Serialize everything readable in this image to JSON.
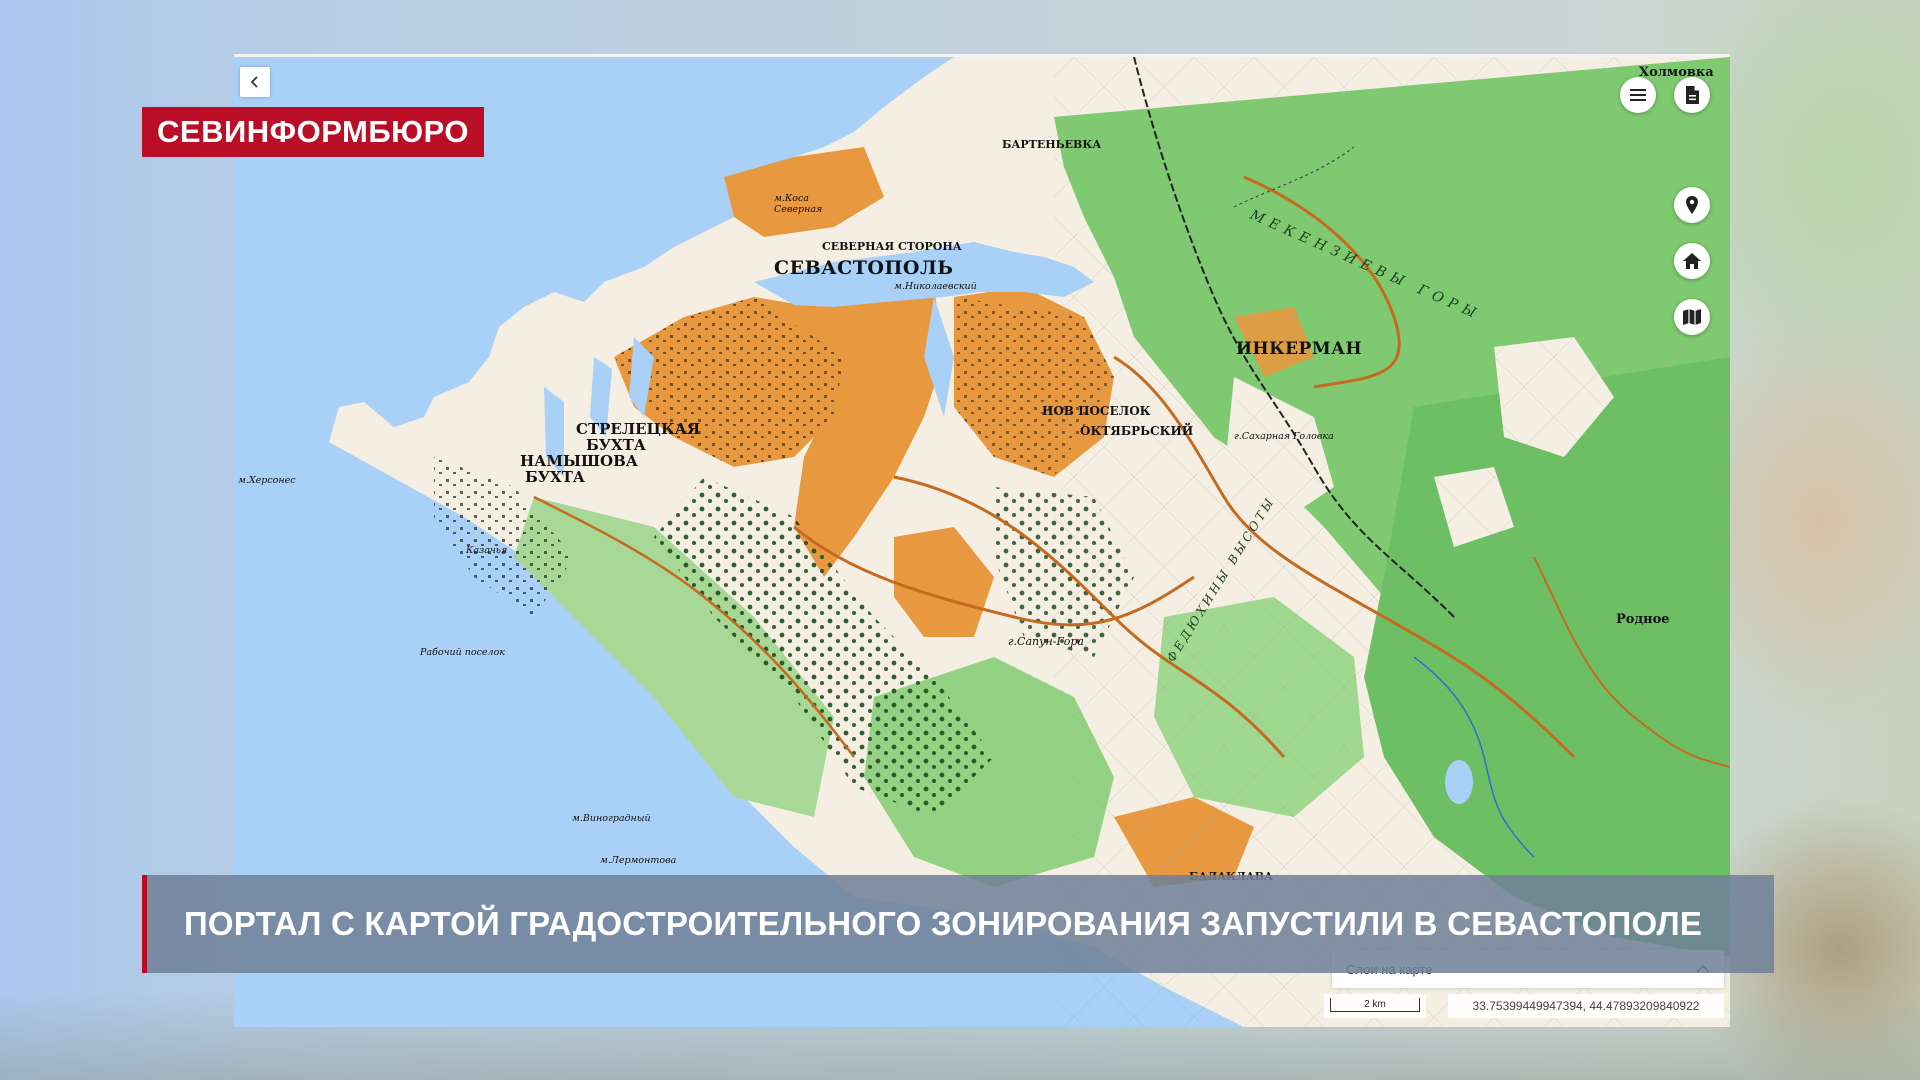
{
  "channel": {
    "logo_text": "СЕВИНФОРМБЮРО"
  },
  "headline": {
    "text": "ПОРТАЛ С КАРТОЙ ГРАДОСТРОИТЕЛЬНОГО ЗОНИРОВАНИЯ ЗАПУСТИЛИ В СЕВАСТОПОЛЕ"
  },
  "map": {
    "labels": {
      "sevastopol": "СЕВАСТОПОЛЬ",
      "inkerman": "ИНКЕРМАН",
      "streletskaya": "СТРЕЛЕЦКАЯ БУХТА",
      "namyshova": "НАМЫШОВА БУХТА",
      "novy_posyolok": "НОВ ПОСЕЛОК",
      "oktyabrsky": "ОКТЯБРЬСКИЙ",
      "bartenevka": "БАРТЕНЬЕВКА",
      "severnaya": "СЕВЕРНАЯ СТОРОНА",
      "kholmovka": "Холмовка",
      "rodnoe": "Родное",
      "balaklava": "БАЛАКЛАВА",
      "khersones": "м.Херсонес",
      "rabochy": "Рабочий поселок",
      "vinogradny": "м.Виноградный",
      "lermontova": "м.Лермонтова",
      "kosa_severnaya": "м.Коса Северная",
      "nikolaevsky": "м.Николаевский",
      "sapun_gora": "г.Сапун-Гора",
      "fedyukhiny": "ФЕДЮХИНЫ ВЫСОТЫ",
      "mekenzievy": "МЕКЕНЗИЕВЫ ГОРЫ",
      "kazachya": "Казачья",
      "sakharnaya": "г.Сахарная Головка"
    },
    "layers_panel": {
      "title": "Слои на карте"
    },
    "scale": {
      "label": "2 km"
    },
    "coordinates": "33.75399449947394, 44.47893209840922",
    "icons": [
      "chevron-left-icon",
      "menu-icon",
      "document-icon",
      "map-pin-icon",
      "home-icon",
      "map-icon",
      "chevron-up-icon"
    ],
    "colors": {
      "sea": "#a9d0f7",
      "urban": "#e8983f",
      "forest": "#6fc36a",
      "logo_red": "#b90e26",
      "ticker_bg": "#708098"
    }
  }
}
